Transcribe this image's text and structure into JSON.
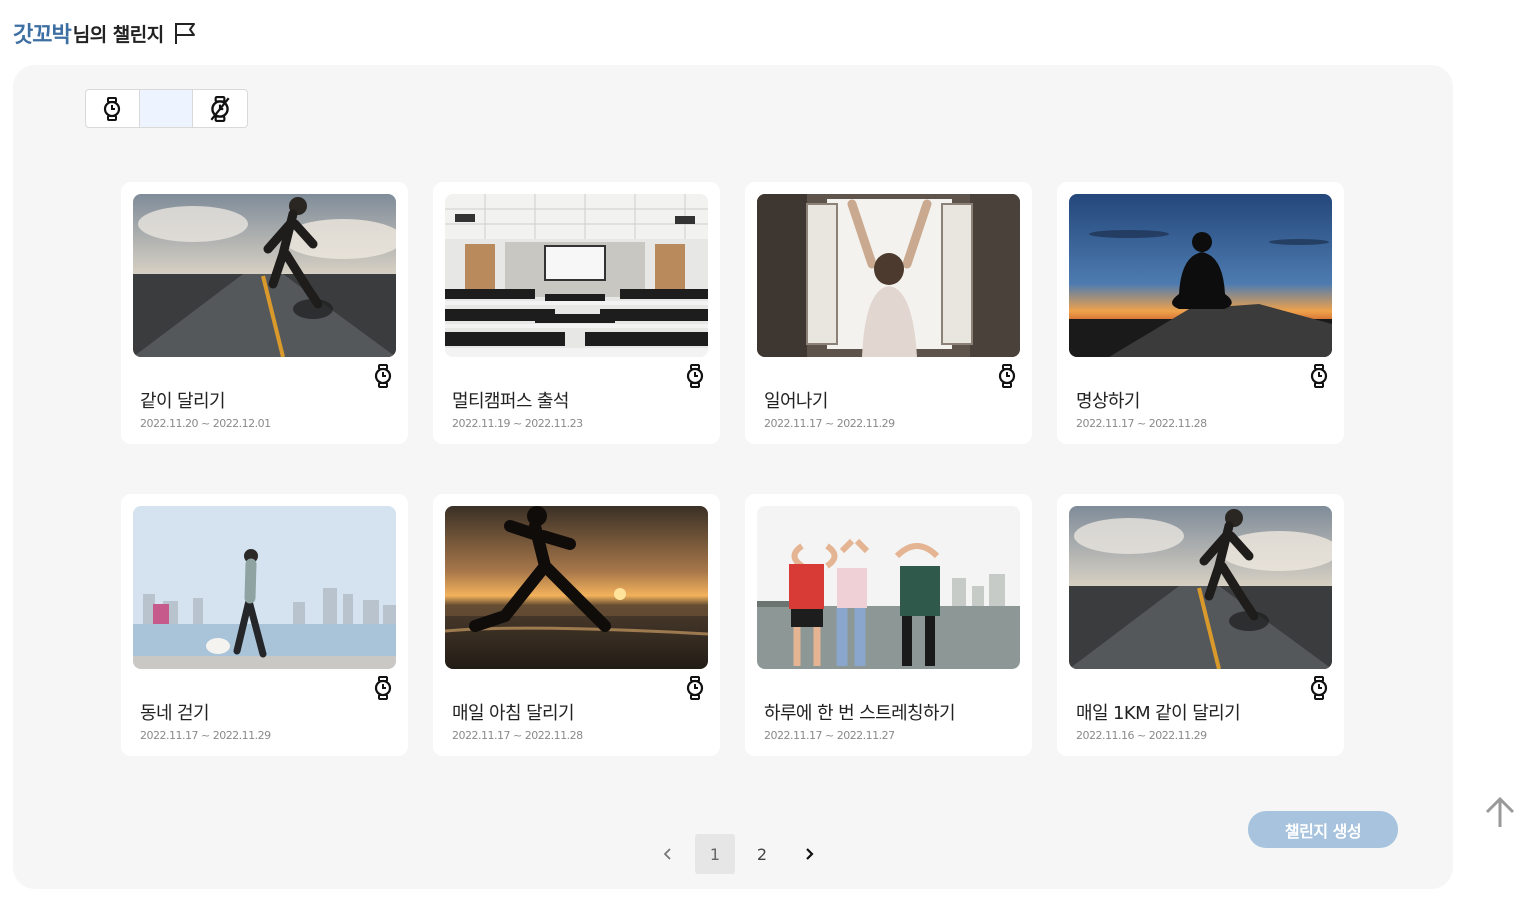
{
  "header": {
    "user_name": "갓꼬박",
    "title_suffix": "님의 챌린지",
    "flag_icon": "flag-icon"
  },
  "filters": [
    {
      "icon": "watch-icon",
      "selected": false
    },
    {
      "icon": "blank",
      "selected": true
    },
    {
      "icon": "watch-off-icon",
      "selected": false
    }
  ],
  "challenges": [
    {
      "title": "같이 달리기",
      "date": "2022.11.20 ~ 2022.12.01",
      "image": "runner-on-road-photo"
    },
    {
      "title": "멀티캠퍼스 출석",
      "date": "2022.11.19 ~ 2022.11.23",
      "image": "classroom-photo"
    },
    {
      "title": "일어나기",
      "date": "2022.11.17 ~ 2022.11.29",
      "image": "woman-stretching-at-window-photo"
    },
    {
      "title": "명상하기",
      "date": "2022.11.17 ~ 2022.11.28",
      "image": "meditation-sunset-photo"
    },
    {
      "title": "동네 걷기",
      "date": "2022.11.17 ~ 2022.11.29",
      "image": "woman-walking-dog-photo"
    },
    {
      "title": "매일 아침 달리기",
      "date": "2022.11.17 ~ 2022.11.28",
      "image": "beach-runner-sunset-photo"
    },
    {
      "title": "하루에 한 번 스트레칭하기",
      "date": "2022.11.17 ~ 2022.11.27",
      "image": "group-stretching-photo"
    },
    {
      "title": "매일 1KM 같이 달리기",
      "date": "2022.11.16 ~ 2022.11.29",
      "image": "runner-on-road-photo"
    }
  ],
  "create_button": {
    "label": "챌린지 생성"
  },
  "pagination": {
    "pages": [
      "1",
      "2"
    ],
    "current": "1",
    "prev_icon": "chevron-left-icon",
    "next_icon": "chevron-right-icon"
  },
  "scroll_top_icon": "arrow-up-icon",
  "colors": {
    "accent": "#3d6fa3",
    "button": "#a7c3de",
    "panel": "#f6f6f6"
  }
}
